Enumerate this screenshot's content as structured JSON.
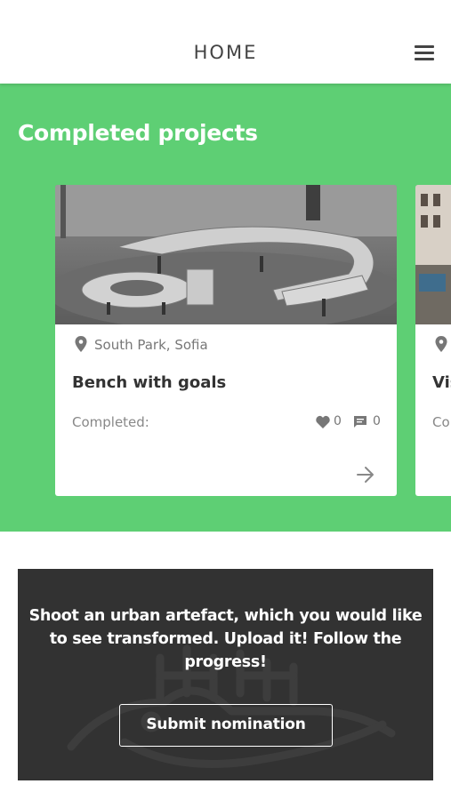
{
  "header": {
    "title": "HOME",
    "menu_icon": "hamburger-menu-icon"
  },
  "colors": {
    "accent_green": "#5ecf74",
    "banner_dark": "#323232"
  },
  "completed": {
    "title": "Completed projects",
    "cards": [
      {
        "location": "South Park, Sofia",
        "title": "Bench with goals",
        "status": "Completed:",
        "likes": "0",
        "comments": "0",
        "icons": [
          "location-pin-icon",
          "heart-icon",
          "comment-icon",
          "arrow-right-icon"
        ]
      },
      {
        "location": "",
        "title": "Vis",
        "status": "Co",
        "icons": [
          "location-pin-icon"
        ]
      }
    ]
  },
  "banner": {
    "text": "Shoot an urban artefact, which you would like to see transformed. Upload it! Follow the progress!",
    "button_label": "Submit nomination"
  }
}
